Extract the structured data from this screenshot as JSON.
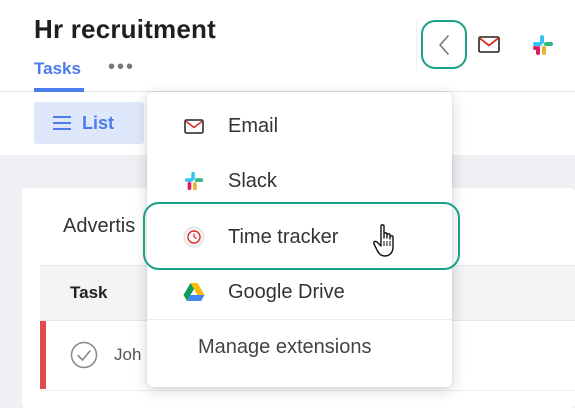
{
  "header": {
    "title": "Hr recruitment",
    "tabs": [
      {
        "label": "Tasks"
      }
    ],
    "more": "•••"
  },
  "toolbar": {
    "list_label": "List"
  },
  "section": {
    "title": "Advertis"
  },
  "table": {
    "columns": [
      "Task"
    ],
    "rows": [
      {
        "name": "Joh"
      }
    ]
  },
  "extensions_menu": {
    "items": [
      {
        "label": "Email",
        "icon": "mail-icon"
      },
      {
        "label": "Slack",
        "icon": "slack-icon"
      },
      {
        "label": "Time tracker",
        "icon": "timer-icon"
      },
      {
        "label": "Google Drive",
        "icon": "google-drive-icon"
      }
    ],
    "manage_label": "Manage extensions"
  },
  "colors": {
    "accent": "#4b7bec",
    "highlight": "#1aa189",
    "flag": "#e04a4a"
  }
}
